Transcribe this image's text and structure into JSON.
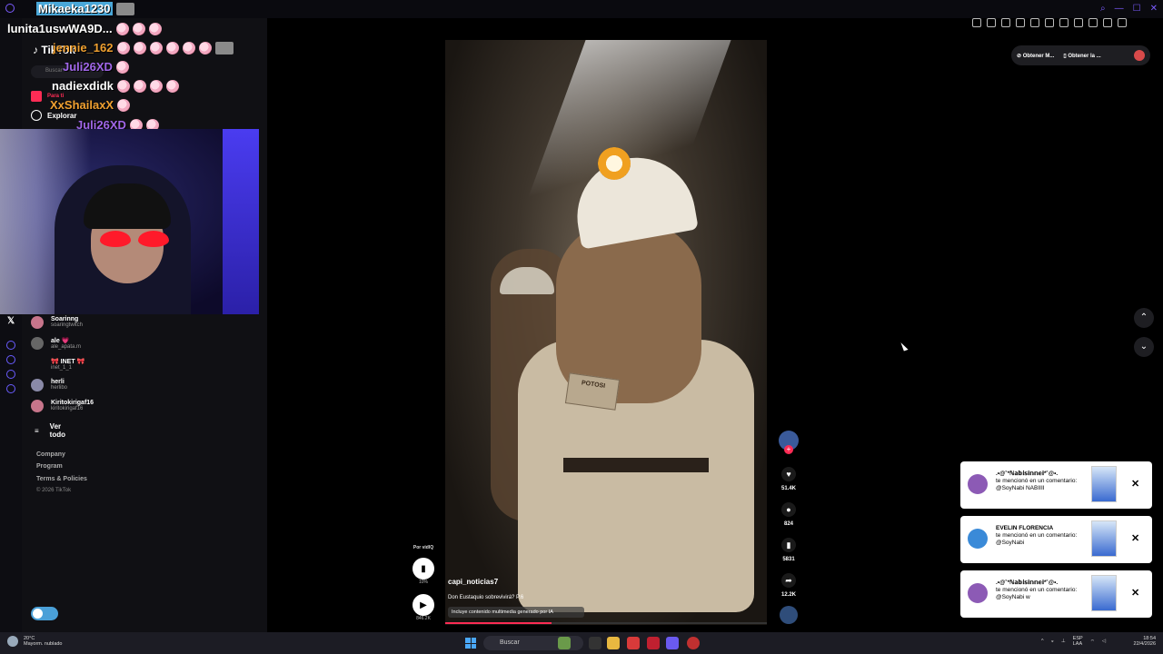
{
  "chat": {
    "lines": [
      {
        "user": "Mikaeka1230",
        "color": "#ffffff",
        "bg": "#4aa7d8"
      },
      {
        "user": "lunita1uswWA9D...",
        "color": "#ffffff"
      },
      {
        "user": "jennie_162",
        "color": "#f0a030"
      },
      {
        "user": "Juli26XD",
        "color": "#a066e8"
      },
      {
        "user": "nadiexdidk",
        "color": "#ffffff"
      },
      {
        "user": "XxShailaxX",
        "color": "#f0a030"
      },
      {
        "user": "Juli26XD",
        "color": "#a066e8"
      }
    ]
  },
  "tiktok": {
    "brand": "TikTok",
    "search_placeholder": "Buscar",
    "nav": [
      {
        "label": "Para ti",
        "icon": "home-icon"
      },
      {
        "label": "Explorar",
        "icon": "compass-icon"
      }
    ],
    "following": [
      {
        "name": "Soarinng",
        "handle": "soaringtwitch"
      },
      {
        "name": "ale 💗",
        "handle": "ale_apata.m"
      },
      {
        "name": "🎀 INET 🎀",
        "handle": "inet_1_1"
      },
      {
        "name": "herli",
        "handle": "herlibo"
      },
      {
        "name": "Kiritokirigaf16",
        "handle": "kiritokirigaf16"
      }
    ],
    "see_all": "Ver todo",
    "footer": [
      "Company",
      "Program",
      "Terms & Policies"
    ],
    "copyright": "© 2026 TikTok"
  },
  "video": {
    "author": "capi_noticias7",
    "description": "Don Eustaquio sobrevivirá? P.6",
    "ai_label": "Incluye contenido multimedia generado por IA",
    "patch_text": "POTOSI",
    "progress": 0.33,
    "likes": "51.4K",
    "comments": "824",
    "saves": "5831",
    "shares": "12.2K",
    "side_label": "Por vidIQ",
    "side_stat": "10%",
    "views": "846.2K"
  },
  "top_buttons": {
    "btn1": "Obtener M...",
    "btn2": "Obtener la ..."
  },
  "notifications": [
    {
      "name": ".•@˚*ℕ𝕒𝕓𝕚𝕤𝕚𝕟𝕟𝕖𝕚*˚@•.",
      "text": "te mencionó en un comentario: @SoyNabi NABIIII"
    },
    {
      "name": "EVELIN FLORENCIA",
      "text": "te mencionó en un comentario: @SoyNabi"
    },
    {
      "name": ".•@˚*ℕ𝕒𝕓𝕚𝕤𝕚𝕟𝕟𝕖𝕚*˚@•.",
      "text": "te mencionó en un comentario: @SoyNabi w"
    }
  ],
  "taskbar": {
    "temp": "20°C",
    "weather": "Mayorm. nublado",
    "search": "Buscar",
    "lang": "ESP",
    "lang2": "LAA",
    "time": "18:54",
    "date": "22/4/2026"
  },
  "colors": {
    "accent": "#fe2c55",
    "brand_purple": "#7b5cff"
  }
}
